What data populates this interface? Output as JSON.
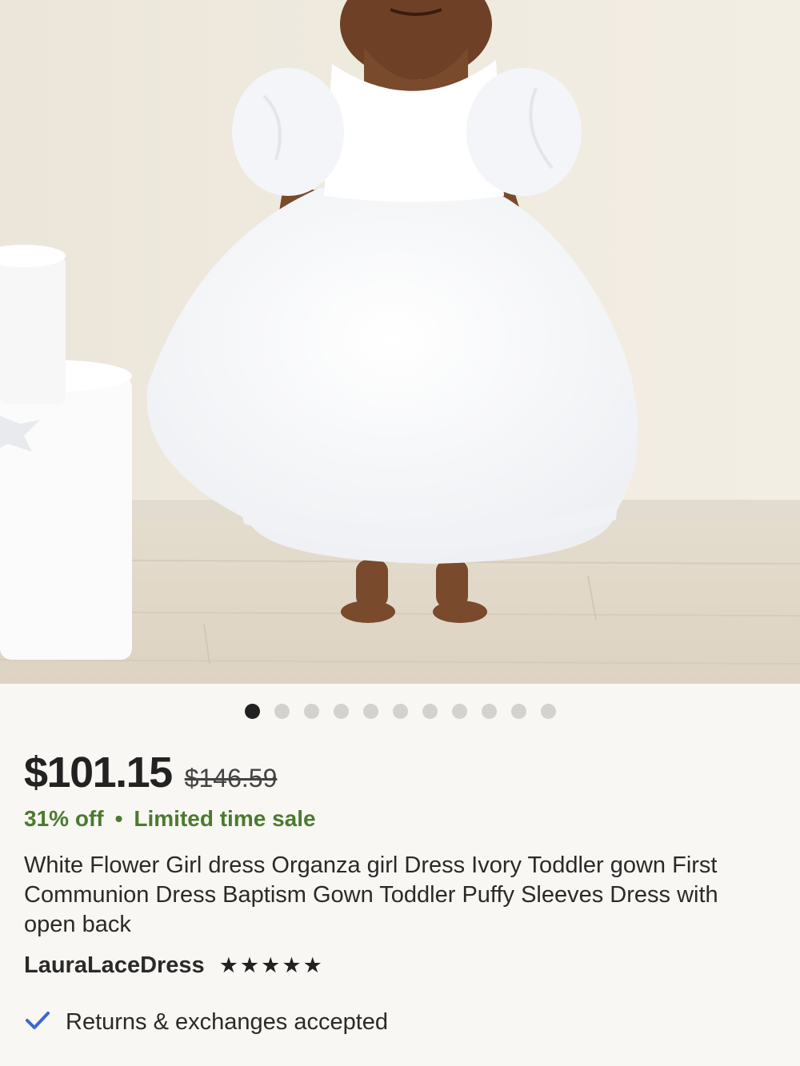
{
  "product": {
    "image_alt": "White organza flower girl dress with puffy sleeves",
    "carousel": {
      "count": 11,
      "active_index": 0
    },
    "price": "$101.15",
    "original_price": "$146.59",
    "discount": "31% off",
    "separator": "•",
    "sale_text": "Limited time sale",
    "title": "White Flower Girl dress Organza girl Dress Ivory Toddler gown First Communion Dress Baptism Gown Toddler Puffy Sleeves Dress with open back",
    "seller": "LauraLaceDress",
    "rating_stars": 5,
    "returns": "Returns & exchanges accepted"
  },
  "colors": {
    "sale_green": "#4b7a2f",
    "check_blue": "#3b67d6",
    "text": "#222222",
    "background": "#f8f7f3"
  },
  "icons": {
    "star": "star-icon",
    "check": "checkmark-icon"
  }
}
